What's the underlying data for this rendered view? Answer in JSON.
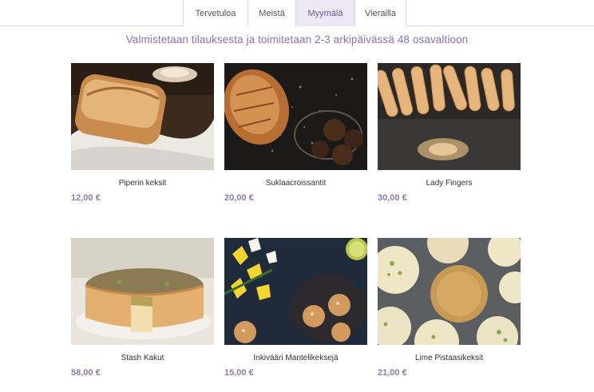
{
  "nav": {
    "tabs": [
      {
        "label": "Tervetuloa"
      },
      {
        "label": "Meistä"
      },
      {
        "label": "Myymälä",
        "active": true
      },
      {
        "label": "Vieraillа"
      }
    ]
  },
  "banner": "Valmistetaan tilauksesta ja toimitetaan 2-3 arkipäivässä 48 osavaltioon",
  "products": [
    {
      "name": "Piperin keksit",
      "price": "12,00 €"
    },
    {
      "name": "Suklaacroissantit",
      "price": "20,00 €"
    },
    {
      "name": "Lady Fingers",
      "price": "30,00 €"
    },
    {
      "name": "Stash Kakut",
      "price": "58,00 €"
    },
    {
      "name": "Inkivääri Mantelikeksejä",
      "price": "15,00 €"
    },
    {
      "name": "Lime Pistaasikeksit",
      "price": "21,00 €"
    }
  ],
  "colors": {
    "accent": "#8a72b8",
    "price": "#8c7ab5",
    "active_tab_bg": "#ece8f5"
  }
}
